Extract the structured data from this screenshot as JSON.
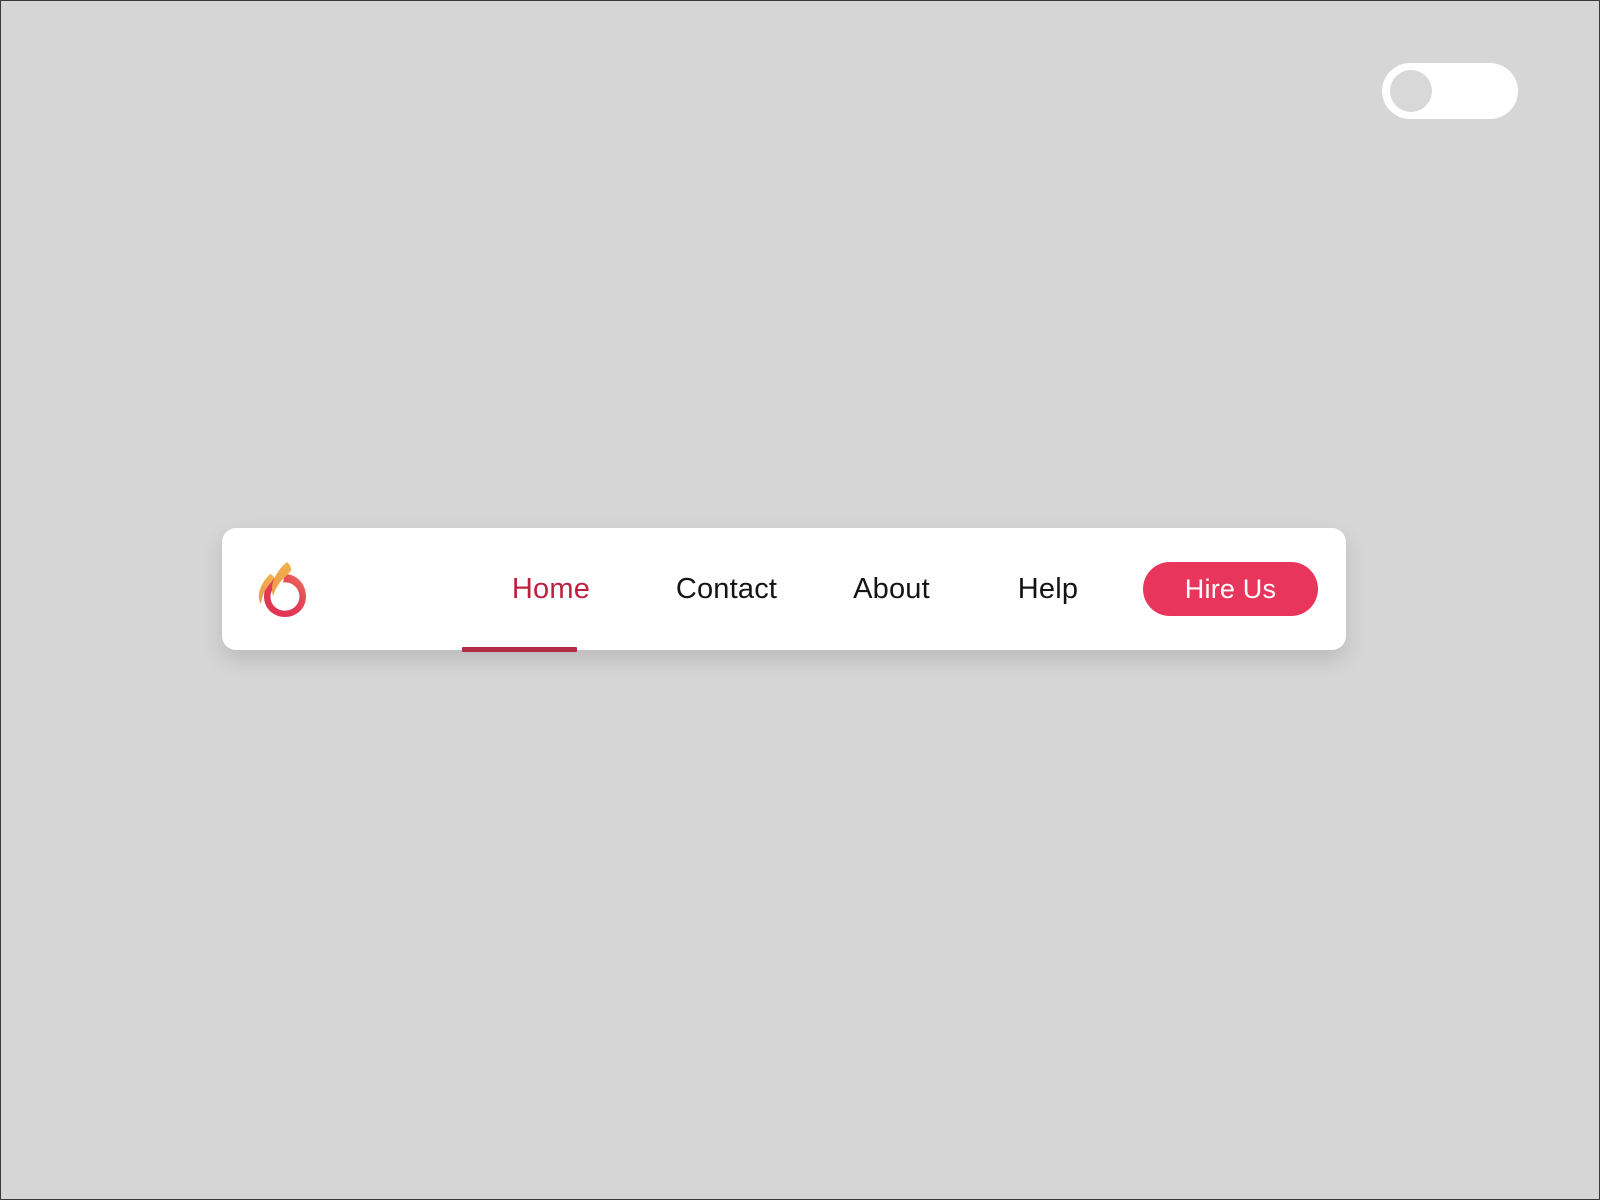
{
  "page": {
    "background_color": "#d6d6d6",
    "border_color": "#3a3a3a"
  },
  "theme_toggle": {
    "name": "dark-mode-toggle",
    "state": "off",
    "aria_label": "Toggle dark mode",
    "track_color": "#ffffff",
    "knob_color": "#d8d8d8"
  },
  "navbar": {
    "background_color": "#ffffff",
    "logo": {
      "name": "flame-logo",
      "alt": "Flame logo",
      "ring_color": "#e03a54",
      "flame_color": "#ef9e46"
    },
    "links": [
      {
        "label": "Home",
        "active": true,
        "color": "#c0203f"
      },
      {
        "label": "Contact",
        "active": false,
        "color": "#141414"
      },
      {
        "label": "About",
        "active": false,
        "color": "#141414"
      },
      {
        "label": "Help",
        "active": false,
        "color": "#141414"
      }
    ],
    "active_indicator_color": "#b42b43",
    "cta": {
      "label": "Hire Us",
      "background_color": "#e8355b",
      "text_color": "#ffffff"
    }
  }
}
